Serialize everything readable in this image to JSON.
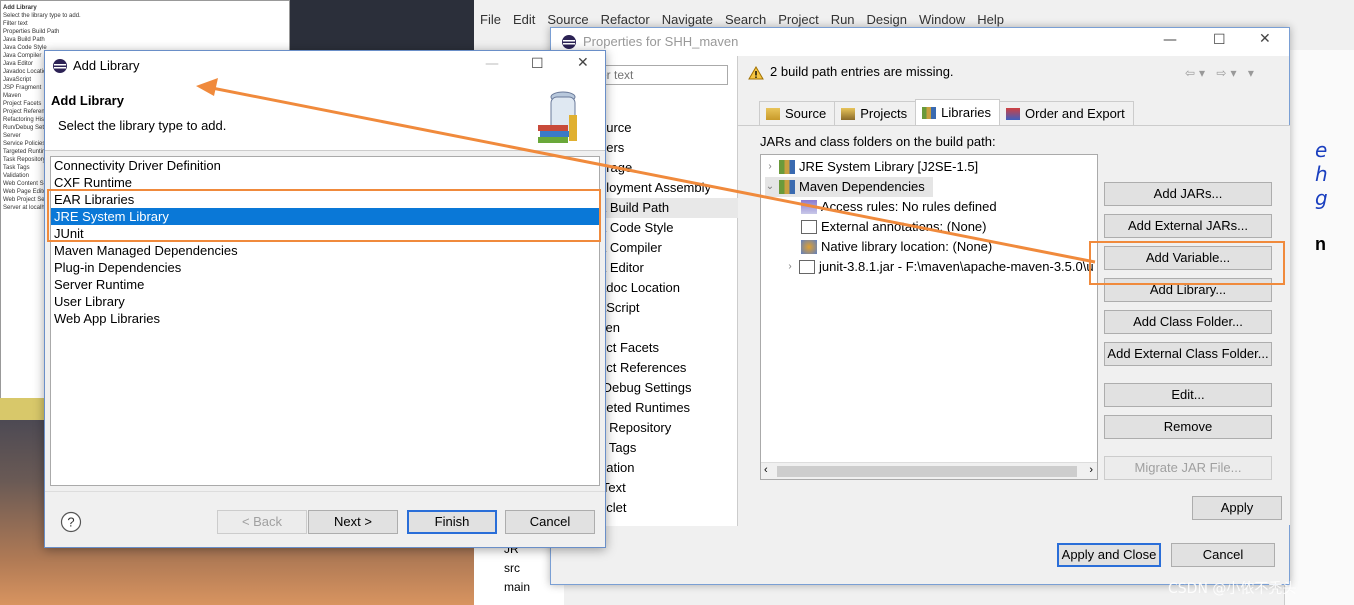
{
  "background": {
    "thumbnail_lines": [
      "Add Library",
      "Select the library type to add.",
      "Filter text",
      "Properties Build Path",
      "Java Build Path",
      "Java Code Style",
      "Java Compiler",
      "Java Editor",
      "Javadoc Location",
      "JavaScript",
      "JSP Fragment",
      "Maven",
      "Project Facets",
      "Project References",
      "Refactoring History",
      "Run/Debug Settings",
      "Server",
      "Service Policies",
      "Targeted Runtimes",
      "Task Repository",
      "Task Tags",
      "Validation",
      "Web Content Settings",
      "Web Page Editor",
      "Web Project Settings",
      "",
      "",
      "",
      "",
      "",
      "",
      "",
      "Server at localhost"
    ],
    "tree": [
      "JR",
      "src",
      "main"
    ]
  },
  "eclipse": {
    "menu": [
      "File",
      "Edit",
      "Source",
      "Refactor",
      "Navigate",
      "Search",
      "Project",
      "Run",
      "Design",
      "Window",
      "Help"
    ]
  },
  "properties": {
    "title": "Properties for SHH_maven",
    "filter_placeholder": "er text",
    "nav_items": [
      "ource",
      "ders",
      "erage",
      "ployment Assembly",
      "a Build Path",
      "a Code Style",
      "a Compiler",
      "a Editor",
      "adoc Location",
      "aScript",
      "ven",
      "ect Facets",
      "ect References",
      "/Debug Settings",
      "geted Runtimes",
      "k Repository",
      "k Tags",
      "dation",
      "iText",
      "oclet"
    ],
    "selected_nav_index": 4,
    "warning": "2 build path entries are missing.",
    "tabs": [
      "Source",
      "Projects",
      "Libraries",
      "Order and Export"
    ],
    "active_tab": "Libraries",
    "panel_label": "JARs and class folders on the build path:",
    "tree": [
      {
        "label": "JRE System Library [J2SE-1.5]",
        "level": 0,
        "chevron": "›"
      },
      {
        "label": "Maven Dependencies",
        "level": 0,
        "chevron": "⌄"
      },
      {
        "label": "Access rules: No rules defined",
        "level": 1
      },
      {
        "label": "External annotations: (None)",
        "level": 1
      },
      {
        "label": "Native library location: (None)",
        "level": 1
      },
      {
        "label": "junit-3.8.1.jar - F:\\maven\\apache-maven-3.5.0\\u",
        "level": 1,
        "chevron": "›"
      }
    ],
    "side_buttons": [
      "Add JARs...",
      "Add External JARs...",
      "Add Variable...",
      "Add Library...",
      "Add Class Folder...",
      "Add External Class Folder...",
      "Edit...",
      "Remove",
      "Migrate JAR File..."
    ],
    "apply": "Apply",
    "apply_close": "Apply and Close",
    "cancel": "Cancel"
  },
  "add_library": {
    "title": "Add Library",
    "heading": "Add Library",
    "description": "Select the library type to add.",
    "items": [
      "Connectivity Driver Definition",
      "CXF Runtime",
      "EAR Libraries",
      "JRE System Library",
      "JUnit",
      "Maven Managed Dependencies",
      "Plug-in Dependencies",
      "Server Runtime",
      "User Library",
      "Web App Libraries"
    ],
    "selected": "JRE System Library",
    "back": "< Back",
    "next": "Next >",
    "finish": "Finish",
    "cancel": "Cancel"
  },
  "right_edge": {
    "glyphs": [
      "e",
      "h",
      "g",
      "n"
    ]
  },
  "watermark": "CSDN @小侬不秃头",
  "colors": {
    "highlight": "#f08a3c",
    "selection": "#0a78d7",
    "arrow": "#f08a3c"
  }
}
